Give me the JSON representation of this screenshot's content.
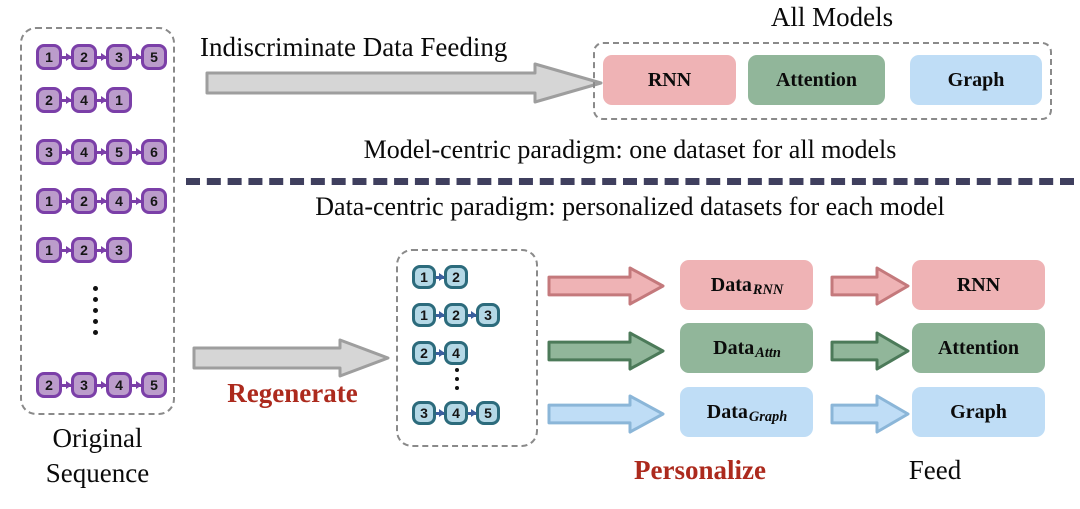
{
  "diagram": {
    "title_all_models": "All Models",
    "top_flow_label": "Indiscriminate Data Feeding",
    "model_centric_line": "Model-centric paradigm: one dataset for all models",
    "data_centric_line": "Data-centric paradigm: personalized datasets for each model",
    "regenerate_label": "Regenerate",
    "personalize_label": "Personalize",
    "feed_label": "Feed",
    "original_caption_line1": "Original",
    "original_caption_line2": "Sequence"
  },
  "colors": {
    "pink": "#efb3b5",
    "pink_border": "#c4797c",
    "green": "#91b69a",
    "green_border": "#4c7a59",
    "blue": "#bfddf6",
    "blue_border": "#8bb6d8",
    "purple_fill": "#bb9ccb",
    "purple_border": "#7b3fa8",
    "teal_fill": "#b4d8e6",
    "teal_border": "#2c6b7c",
    "grey_arrow": "#d5d5d5",
    "grey_arrow_border": "#9b9b9b",
    "dashed_box": "#8a8a8a",
    "divider": "#3f3f5e",
    "red_text": "#ac2a1d"
  },
  "original_sequences": [
    [
      "1",
      "2",
      "3",
      "5"
    ],
    [
      "2",
      "4",
      "1"
    ],
    [
      "3",
      "4",
      "5",
      "6"
    ],
    [
      "1",
      "2",
      "4",
      "6"
    ],
    [
      "1",
      "2",
      "3"
    ],
    [
      "2",
      "3",
      "4",
      "5"
    ]
  ],
  "regenerated_sequences": [
    [
      "1",
      "2"
    ],
    [
      "1",
      "2",
      "3"
    ],
    [
      "2",
      "4"
    ],
    [
      "3",
      "4",
      "5"
    ]
  ],
  "all_models": [
    {
      "label": "RNN",
      "color": "pink"
    },
    {
      "label": "Attention",
      "color": "green"
    },
    {
      "label": "Graph",
      "color": "blue"
    }
  ],
  "personalized_datasets": [
    {
      "base": "Data",
      "sub": "RNN",
      "color": "pink"
    },
    {
      "base": "Data",
      "sub": "Attn",
      "color": "green"
    },
    {
      "base": "Data",
      "sub": "Graph",
      "color": "blue"
    }
  ],
  "fed_models": [
    {
      "label": "RNN",
      "color": "pink"
    },
    {
      "label": "Attention",
      "color": "green"
    },
    {
      "label": "Graph",
      "color": "blue"
    }
  ]
}
